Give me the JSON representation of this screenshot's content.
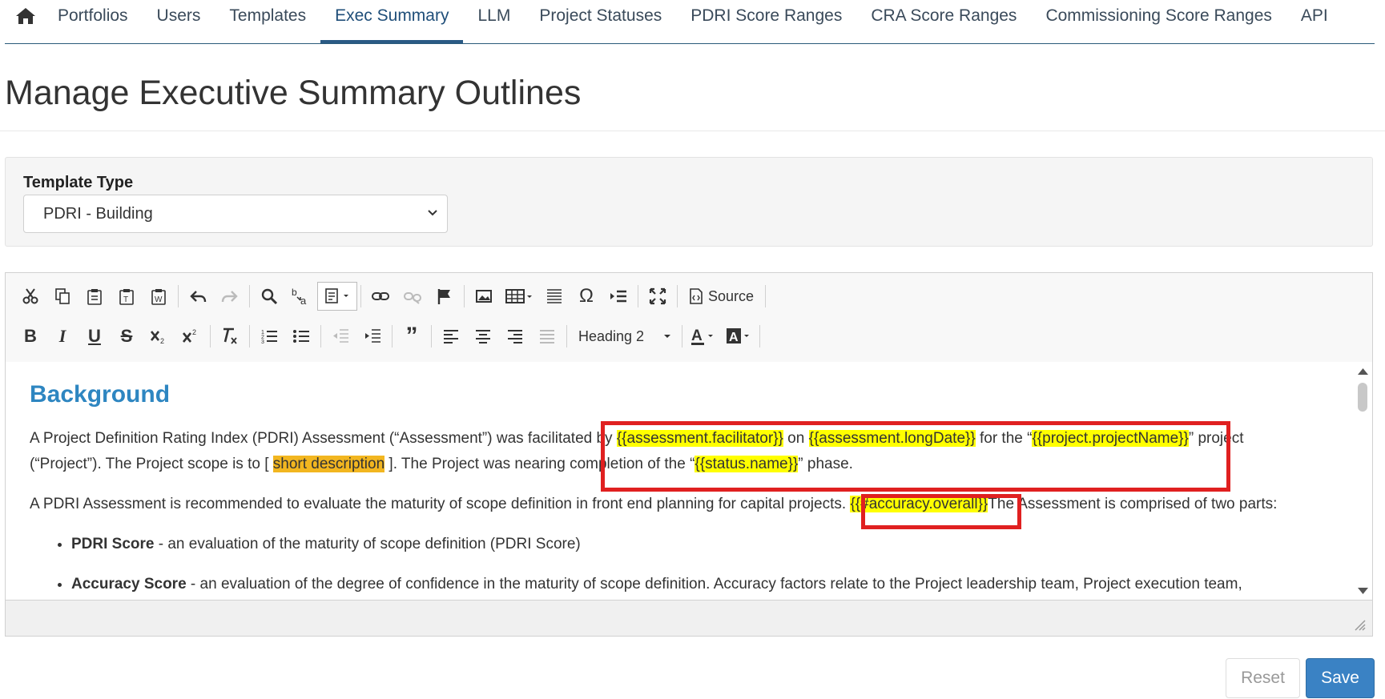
{
  "nav": {
    "tabs": [
      "Portfolios",
      "Users",
      "Templates",
      "Exec Summary",
      "LLM",
      "Project Statuses",
      "PDRI Score Ranges",
      "CRA Score Ranges",
      "Commissioning Score Ranges",
      "API"
    ],
    "active": "Exec Summary"
  },
  "page": {
    "title": "Manage Executive Summary Outlines"
  },
  "template": {
    "label": "Template Type",
    "value": "PDRI - Building"
  },
  "toolbar": {
    "format_combo": "Heading 2",
    "source_label": "Source"
  },
  "content": {
    "heading": "Background",
    "p1_a": "A Project Definition Rating Index (PDRI) Assessment (“Assessment”) was facilitated by ",
    "p1_facilitator": "{{assessment.facilitator}}",
    "p1_b": " on ",
    "p1_date": "{{assessment.longDate}}",
    "p1_c": " for the “",
    "p1_project": "{{project.projectName}}",
    "p1_d": "” project",
    "p2_a": "(“Project”). The Project scope is to [ ",
    "p2_short": "short description",
    "p2_b": " ].  The Project was nearing completion of the “",
    "p2_status": "{{status.name}}",
    "p2_c": "” phase.",
    "p3_a": "A PDRI Assessment is recommended to evaluate the maturity of scope definition in front end planning for capital projects. ",
    "p3_accuracy": "{{#accuracy.overall}}",
    "p3_b": "The Assessment is comprised of two parts:",
    "li1_bold": "PDRI Score",
    "li1_text": " - an evaluation of the maturity of scope definition (PDRI Score)",
    "li2_bold": "Accuracy Score",
    "li2_text": " - an evaluation of the degree of confidence in the maturity of scope definition. Accuracy factors relate to the Project leadership team, Project execution team,"
  },
  "actions": {
    "reset": "Reset",
    "save": "Save"
  },
  "colors": {
    "accent": "#3a82c4",
    "heading": "#2e86c1",
    "highlight": "#ffff00",
    "highlight_orange": "#f2b620",
    "annotation": "#e02020"
  }
}
